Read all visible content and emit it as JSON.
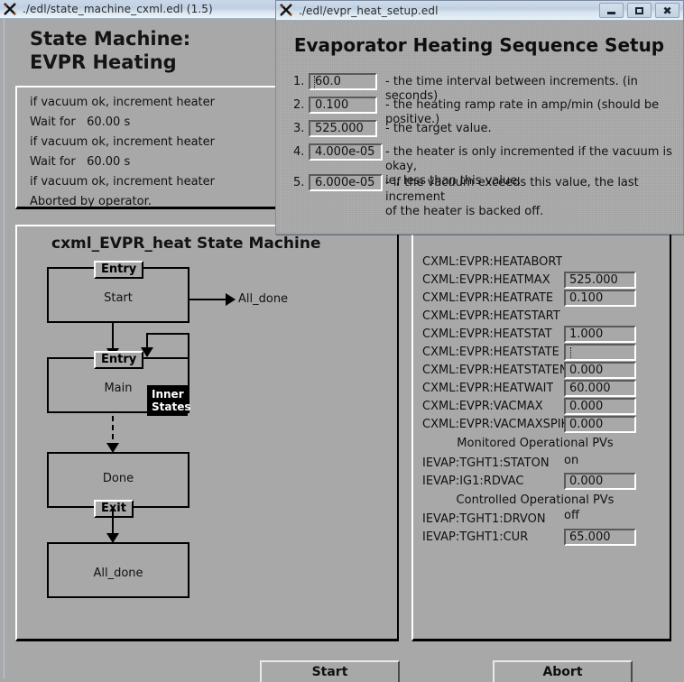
{
  "main_window": {
    "title": "./edl/state_machine_cxml.edl (1.5)",
    "icon": "x-app-icon",
    "headline_line1": "State Machine:",
    "headline_line2": "EVPR Heating",
    "log_lines": [
      "if vacuum ok, increment heater",
      "Wait for   60.00 s",
      "if vacuum ok, increment heater",
      "Wait for   60.00 s",
      "if vacuum ok, increment heater",
      "Aborted by operator."
    ],
    "state_machine_title": "cxml_EVPR_heat State Machine",
    "states": [
      {
        "name": "Start",
        "tag": "Entry"
      },
      {
        "name": "Main",
        "tag": "Entry",
        "inner_tag_line1": "Inner",
        "inner_tag_line2": "States"
      },
      {
        "name": "Done",
        "tag": "Exit"
      },
      {
        "name": "All_done",
        "tag": ""
      }
    ],
    "edge_label_all_done": "All_done",
    "pv_rows": [
      {
        "name": "CXML:EVPR:HEATABORT",
        "value": "",
        "has_field": false
      },
      {
        "name": "CXML:EVPR:HEATMAX",
        "value": "525.000",
        "has_field": true
      },
      {
        "name": "CXML:EVPR:HEATRATE",
        "value": "0.100",
        "has_field": true
      },
      {
        "name": "CXML:EVPR:HEATSTART",
        "value": "",
        "has_field": false
      },
      {
        "name": "CXML:EVPR:HEATSTAT",
        "value": "1.000",
        "has_field": true
      },
      {
        "name": "CXML:EVPR:HEATSTATE",
        "value": "",
        "has_field": true
      },
      {
        "name": "CXML:EVPR:HEATSTATENO",
        "value": "0.000",
        "has_field": true
      },
      {
        "name": "CXML:EVPR:HEATWAIT",
        "value": "60.000",
        "has_field": true
      },
      {
        "name": "CXML:EVPR:VACMAX",
        "value": "0.000",
        "has_field": true
      },
      {
        "name": "CXML:EVPR:VACMAXSPIKE",
        "value": "0.000",
        "has_field": true
      }
    ],
    "section_monitored": "Monitored Operational PVs",
    "monitored_rows": [
      {
        "name": "IEVAP:TGHT1:STATON",
        "value": "on",
        "has_field": false
      },
      {
        "name": "IEVAP:IG1:RDVAC",
        "value": "0.000",
        "has_field": true
      }
    ],
    "section_controlled": "Controlled Operational PVs",
    "controlled_rows": [
      {
        "name": "IEVAP:TGHT1:DRVON",
        "value": "off",
        "has_field": false
      },
      {
        "name": "IEVAP:TGHT1:CUR",
        "value": "65.000",
        "has_field": true
      }
    ],
    "start_button": "Start",
    "abort_button": "Abort"
  },
  "dialog": {
    "title": "./edl/evpr_heat_setup.edl",
    "icon": "x-app-icon",
    "heading": "Evaporator Heating Sequence Setup",
    "titlebar_buttons": {
      "minimize": "minimize-icon",
      "maximize": "maximize-icon",
      "close": "close-icon"
    },
    "rows": [
      {
        "num": "1.",
        "value": "60.0",
        "desc": "- the time interval between increments. (in seconds)"
      },
      {
        "num": "2.",
        "value": "0.100",
        "desc": "- the heating ramp rate in amp/min (should be positive.)"
      },
      {
        "num": "3.",
        "value": "525.000",
        "desc": "- the target value."
      },
      {
        "num": "4.",
        "value": "4.000e-05",
        "desc": "- the heater is only incremented if the vacuum is okay,\n  ie, less than this value."
      },
      {
        "num": "5.",
        "value": "6.000e-05",
        "desc": "- if the vacuum exceeds this value, the last increment\n  of the heater is backed off."
      }
    ]
  },
  "colors": {
    "widget_gray": "#a8a8a8",
    "titlebar_blue": "#c9d8e8",
    "desktop": "#c8d8e8",
    "text": "#111111"
  }
}
